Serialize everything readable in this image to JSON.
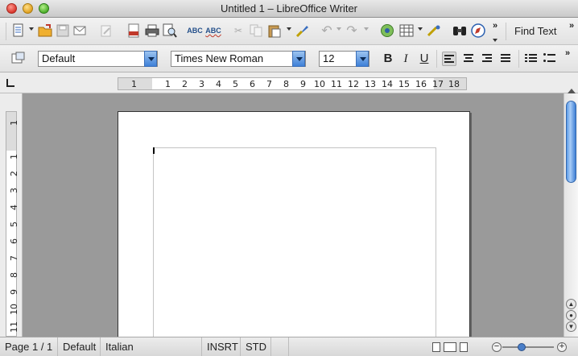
{
  "window": {
    "title": "Untitled 1 – LibreOffice Writer"
  },
  "toolbar": {
    "icons": [
      "new-document-icon",
      "open-icon",
      "save-icon",
      "email-icon",
      "edit-file-icon",
      "export-pdf-icon",
      "print-icon",
      "print-preview-icon",
      "spellcheck-icon",
      "autospellcheck-icon",
      "cut-icon",
      "copy-icon",
      "paste-icon",
      "format-paintbrush-icon",
      "undo-icon",
      "redo-icon",
      "navigator-icon",
      "table-icon",
      "draw-functions-icon",
      "find-replace-icon",
      "navigator-compass-icon"
    ],
    "find_text_label": "Find Text",
    "more_label": "»"
  },
  "formatting": {
    "paragraph_style": "Default",
    "font_name": "Times New Roman",
    "font_size": "12",
    "bold_label": "B",
    "italic_label": "I",
    "underline_label": "U",
    "more_label": "»"
  },
  "ruler": {
    "horizontal_marks": [
      "1",
      "1",
      "2",
      "3",
      "4",
      "5",
      "6",
      "7",
      "8",
      "9",
      "10",
      "11",
      "12",
      "13",
      "14",
      "15",
      "16",
      "17",
      "18"
    ],
    "vertical_marks": [
      "1",
      "1",
      "2",
      "3",
      "4",
      "5",
      "6",
      "7",
      "8",
      "9",
      "10",
      "11"
    ]
  },
  "status": {
    "page": "Page 1 / 1",
    "page_style": "Default",
    "language": "Italian",
    "insert_mode": "INSRT",
    "selection_mode": "STD"
  },
  "colors": {
    "accent": "#3f80d8",
    "workspace": "#9a9a9a"
  }
}
